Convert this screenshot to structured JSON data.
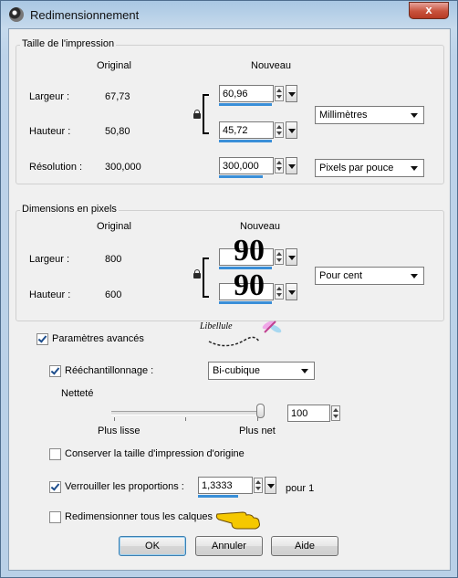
{
  "window": {
    "title": "Redimensionnement",
    "close_symbol": "x"
  },
  "print_size": {
    "group_title": "Taille de l'impression",
    "col_original": "Original",
    "col_new": "Nouveau",
    "width_label": "Largeur :",
    "width_original": "67,73",
    "width_new": "60,96",
    "height_label": "Hauteur :",
    "height_original": "50,80",
    "height_new": "45,72",
    "unit_select": "Millimètres",
    "resolution_label": "Résolution :",
    "resolution_original": "300,000",
    "resolution_new": "300,000",
    "resolution_unit_select": "Pixels par pouce"
  },
  "pixel_size": {
    "group_title": "Dimensions en pixels",
    "col_original": "Original",
    "col_new": "Nouveau",
    "width_label": "Largeur :",
    "width_original": "800",
    "width_new": "90",
    "height_label": "Hauteur :",
    "height_original": "600",
    "height_new": "90",
    "unit_select": "Pour cent"
  },
  "advanced": {
    "advanced_label": "Paramètres avancés",
    "advanced_checked": true,
    "resample_label": "Rééchantillonnage :",
    "resample_checked": true,
    "resample_select": "Bi-cubique",
    "sharpness_label": "Netteté",
    "sharpness_min_label": "Plus lisse",
    "sharpness_max_label": "Plus net",
    "sharpness_value": "100",
    "sharpness_fraction": 1.0,
    "keep_print_size_label": "Conserver la taille d'impression d'origine",
    "keep_print_size_checked": false,
    "lock_ratio_label": "Verrouiller les proportions :",
    "lock_ratio_checked": true,
    "ratio_value": "1,3333",
    "ratio_suffix": "pour 1",
    "resize_all_layers_label": "Redimensionner tous les calques",
    "resize_all_layers_checked": false
  },
  "watermark": {
    "text": "Libellule"
  },
  "buttons": {
    "ok": "OK",
    "cancel": "Annuler",
    "help": "Aide"
  },
  "icons": {
    "app": "app-icon",
    "close": "close-icon",
    "lock": "lock-icon",
    "spin_arrows": "spin-arrows-icon",
    "dropdown": "chevron-down-icon",
    "pointer": "pointing-hand-icon",
    "dragonfly": "dragonfly-icon"
  },
  "colors": {
    "title_gradient_top": "#a9c7e3",
    "close_button": "#c8523c",
    "accent_bar": "#3a8fd8",
    "pointer_hand": "#f5c800"
  }
}
